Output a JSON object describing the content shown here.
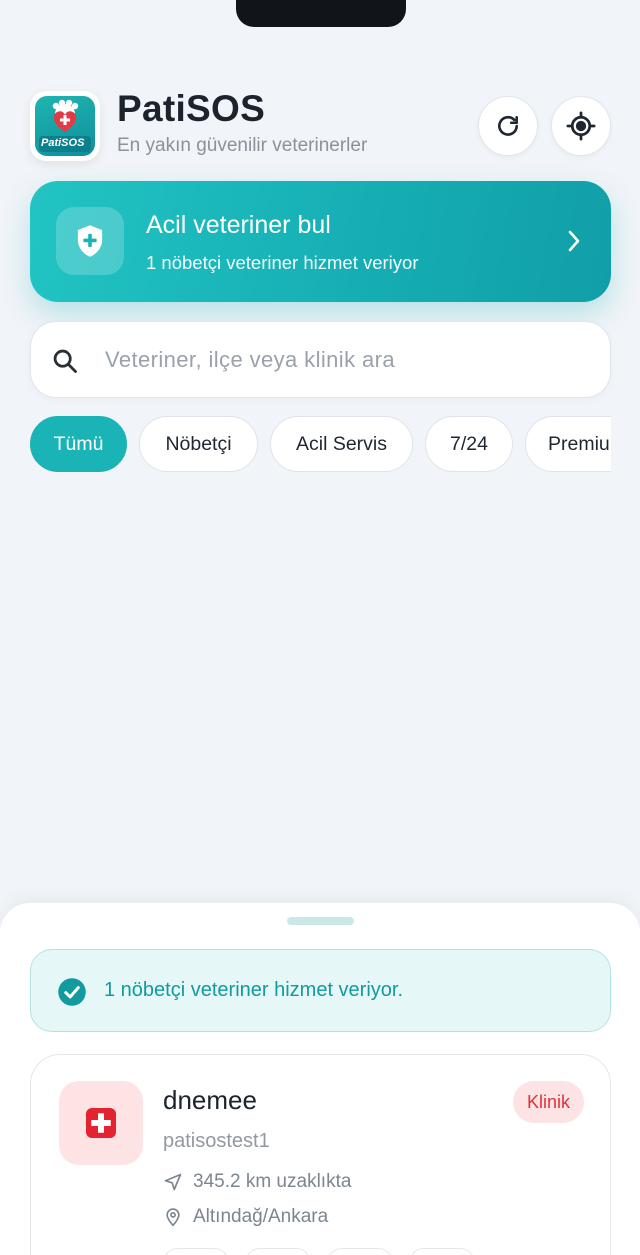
{
  "app": {
    "title": "PatiSOS",
    "subtitle": "En yakın güvenilir veterinerler",
    "logo_text": "PatiSOS"
  },
  "header_buttons": {
    "refresh_icon": "refresh-icon",
    "locate_icon": "crosshair-icon"
  },
  "emergency": {
    "title": "Acil veteriner bul",
    "subtitle": "1 nöbetçi veteriner hizmet veriyor",
    "icon": "shield-plus-icon"
  },
  "search": {
    "placeholder": "Veteriner, ilçe veya klinik ara",
    "value": ""
  },
  "filters": [
    {
      "label": "Tümü",
      "active": true
    },
    {
      "label": "Nöbetçi",
      "active": false
    },
    {
      "label": "Acil Servis",
      "active": false
    },
    {
      "label": "7/24",
      "active": false
    },
    {
      "label": "Premium",
      "active": false
    }
  ],
  "sheet": {
    "notice": "1 nöbetçi veteriner hizmet veriyor.",
    "results": [
      {
        "name": "dnemee",
        "owner": "patisostest1",
        "distance": "345.2 km uzaklıkta",
        "location": "Altındağ/Ankara",
        "badge": "Klinik"
      }
    ]
  },
  "colors": {
    "accent": "#1bb4b6",
    "badge_red": "#e1313c",
    "background": "#f1f4f8"
  }
}
